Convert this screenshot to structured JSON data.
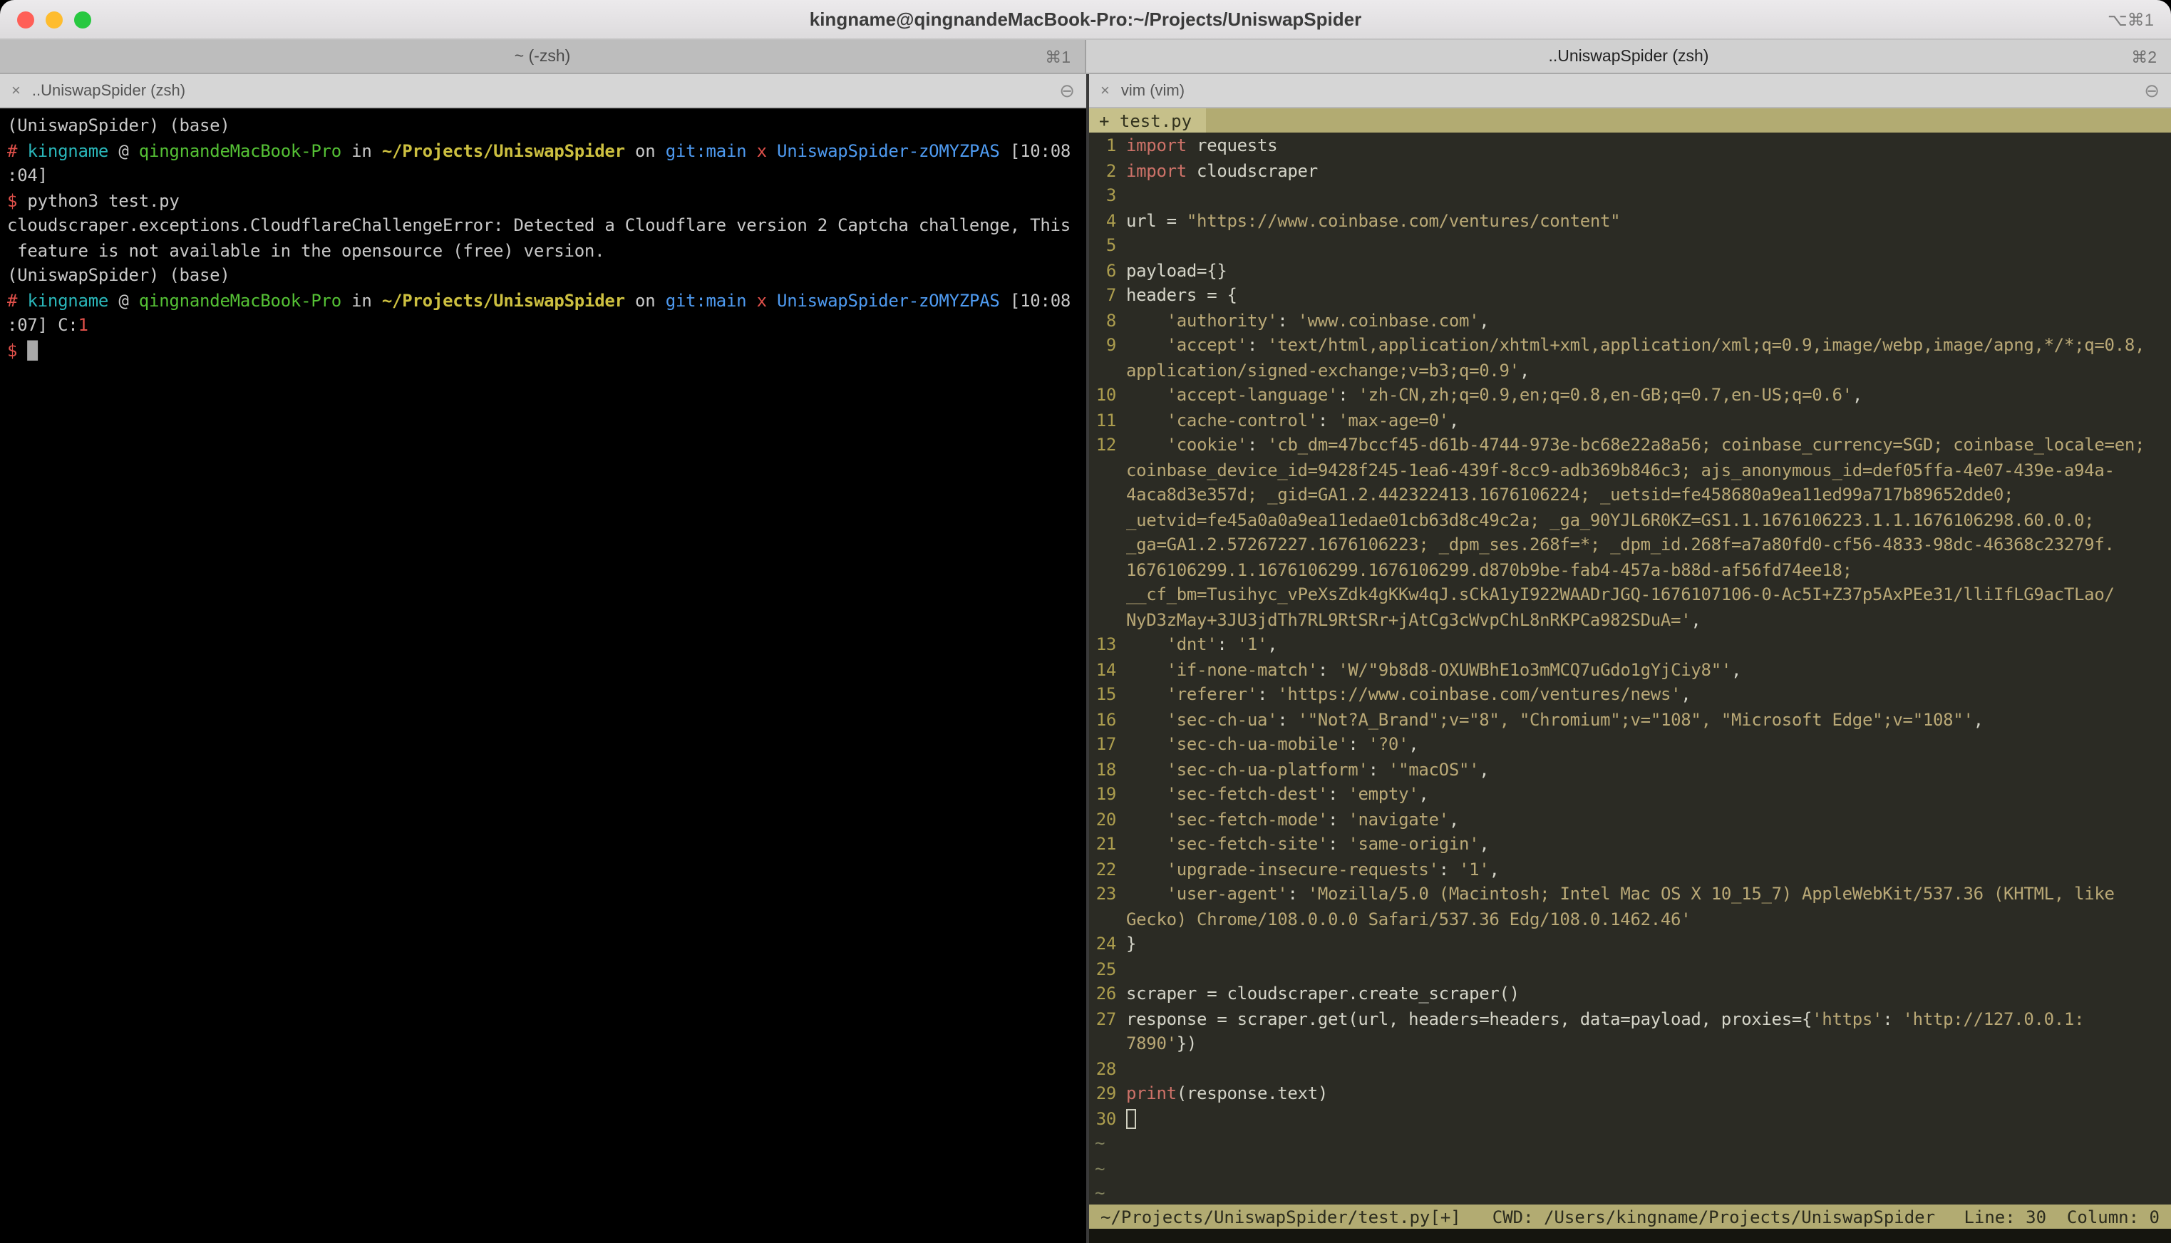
{
  "window": {
    "title": "kingname@qingnandeMacBook-Pro:~/Projects/UniswapSpider",
    "shortcut": "⌥⌘1"
  },
  "tabs": [
    {
      "label": "~ (-zsh)",
      "shortcut": "⌘1"
    },
    {
      "label": "..UniswapSpider (zsh)",
      "shortcut": "⌘2"
    }
  ],
  "left_pane": {
    "title": "..UniswapSpider (zsh)",
    "close_icon": "×",
    "menu_icon": "⊖",
    "lines": [
      [
        {
          "t": "(UniswapSpider) (base)",
          "c": "w"
        }
      ],
      [
        {
          "t": "# ",
          "c": "r"
        },
        {
          "t": "kingname",
          "c": "cy"
        },
        {
          "t": " @ ",
          "c": "w"
        },
        {
          "t": "qingnandeMacBook-Pro",
          "c": "g"
        },
        {
          "t": " in ",
          "c": "w"
        },
        {
          "t": "~/Projects/UniswapSpider",
          "c": "yb"
        },
        {
          "t": " on ",
          "c": "w"
        },
        {
          "t": "git:main",
          "c": "b"
        },
        {
          "t": " x ",
          "c": "r"
        },
        {
          "t": "UniswapSpider-zOMYZPAS",
          "c": "b"
        },
        {
          "t": " [10:08",
          "c": "w"
        }
      ],
      [
        {
          "t": ":04]",
          "c": "w"
        }
      ],
      [
        {
          "t": "$",
          "c": "r"
        },
        {
          "t": " python3 test.py",
          "c": "w"
        }
      ],
      [
        {
          "t": "cloudscraper.exceptions.CloudflareChallengeError: Detected a Cloudflare version 2 Captcha challenge, This",
          "c": "w"
        }
      ],
      [
        {
          "t": " feature is not available in the opensource (free) version.",
          "c": "w"
        }
      ],
      [
        {
          "t": "(UniswapSpider) (base)",
          "c": "w"
        }
      ],
      [
        {
          "t": "# ",
          "c": "r"
        },
        {
          "t": "kingname",
          "c": "cy"
        },
        {
          "t": " @ ",
          "c": "w"
        },
        {
          "t": "qingnandeMacBook-Pro",
          "c": "g"
        },
        {
          "t": " in ",
          "c": "w"
        },
        {
          "t": "~/Projects/UniswapSpider",
          "c": "yb"
        },
        {
          "t": " on ",
          "c": "w"
        },
        {
          "t": "git:main",
          "c": "b"
        },
        {
          "t": " x ",
          "c": "r"
        },
        {
          "t": "UniswapSpider-zOMYZPAS",
          "c": "b"
        },
        {
          "t": " [10:08",
          "c": "w"
        }
      ],
      [
        {
          "t": ":07] ",
          "c": "w"
        },
        {
          "t": "C:",
          "c": "w"
        },
        {
          "t": "1",
          "c": "r"
        }
      ],
      [
        {
          "t": "$ ",
          "c": "r"
        },
        {
          "t": "█",
          "c": "curf"
        }
      ]
    ]
  },
  "right_pane": {
    "title": "vim (vim)",
    "close_icon": "×",
    "menu_icon": "⊖",
    "tabline": "+ test.py",
    "rows": [
      {
        "n": "1",
        "s": [
          {
            "t": "import",
            "c": "kw"
          },
          {
            "t": " requests",
            "c": "p"
          }
        ]
      },
      {
        "n": "2",
        "s": [
          {
            "t": "import",
            "c": "kw"
          },
          {
            "t": " cloudscraper",
            "c": "p"
          }
        ]
      },
      {
        "n": "3",
        "s": []
      },
      {
        "n": "4",
        "s": [
          {
            "t": "url = ",
            "c": "p"
          },
          {
            "t": "\"https://www.coinbase.com/ventures/content\"",
            "c": "s"
          }
        ]
      },
      {
        "n": "5",
        "s": []
      },
      {
        "n": "6",
        "s": [
          {
            "t": "payload={}",
            "c": "p"
          }
        ]
      },
      {
        "n": "7",
        "s": [
          {
            "t": "headers = {",
            "c": "p"
          }
        ]
      },
      {
        "n": "8",
        "s": [
          {
            "t": "    ",
            "c": "p"
          },
          {
            "t": "'authority'",
            "c": "s"
          },
          {
            "t": ": ",
            "c": "p"
          },
          {
            "t": "'www.coinbase.com'",
            "c": "s"
          },
          {
            "t": ",",
            "c": "p"
          }
        ]
      },
      {
        "n": "9",
        "s": [
          {
            "t": "    ",
            "c": "p"
          },
          {
            "t": "'accept'",
            "c": "s"
          },
          {
            "t": ": ",
            "c": "p"
          },
          {
            "t": "'text/html,application/xhtml+xml,application/xml;q=0.9,image/webp,image/apng,*/*;q=0.8,",
            "c": "s"
          }
        ]
      },
      {
        "n": "",
        "s": [
          {
            "t": "application/signed-exchange;v=b3;q=0.9'",
            "c": "s"
          },
          {
            "t": ",",
            "c": "p"
          }
        ]
      },
      {
        "n": "10",
        "s": [
          {
            "t": "    ",
            "c": "p"
          },
          {
            "t": "'accept-language'",
            "c": "s"
          },
          {
            "t": ": ",
            "c": "p"
          },
          {
            "t": "'zh-CN,zh;q=0.9,en;q=0.8,en-GB;q=0.7,en-US;q=0.6'",
            "c": "s"
          },
          {
            "t": ",",
            "c": "p"
          }
        ]
      },
      {
        "n": "11",
        "s": [
          {
            "t": "    ",
            "c": "p"
          },
          {
            "t": "'cache-control'",
            "c": "s"
          },
          {
            "t": ": ",
            "c": "p"
          },
          {
            "t": "'max-age=0'",
            "c": "s"
          },
          {
            "t": ",",
            "c": "p"
          }
        ]
      },
      {
        "n": "12",
        "s": [
          {
            "t": "    ",
            "c": "p"
          },
          {
            "t": "'cookie'",
            "c": "s"
          },
          {
            "t": ": ",
            "c": "p"
          },
          {
            "t": "'cb_dm=47bccf45-d61b-4744-973e-bc68e22a8a56; coinbase_currency=SGD; coinbase_locale=en;",
            "c": "s"
          }
        ]
      },
      {
        "n": "",
        "s": [
          {
            "t": "coinbase_device_id=9428f245-1ea6-439f-8cc9-adb369b846c3; ajs_anonymous_id=def05ffa-4e07-439e-a94a-",
            "c": "s"
          }
        ]
      },
      {
        "n": "",
        "s": [
          {
            "t": "4aca8d3e357d; _gid=GA1.2.442322413.1676106224; _uetsid=fe458680a9ea11ed99a717b89652dde0;",
            "c": "s"
          }
        ]
      },
      {
        "n": "",
        "s": [
          {
            "t": "_uetvid=fe45a0a0a9ea11edae01cb63d8c49c2a; _ga_90YJL6R0KZ=GS1.1.1676106223.1.1.1676106298.60.0.0;",
            "c": "s"
          }
        ]
      },
      {
        "n": "",
        "s": [
          {
            "t": "_ga=GA1.2.57267227.1676106223; _dpm_ses.268f=*; _dpm_id.268f=a7a80fd0-cf56-4833-98dc-46368c23279f.",
            "c": "s"
          }
        ]
      },
      {
        "n": "",
        "s": [
          {
            "t": "1676106299.1.1676106299.1676106299.d870b9be-fab4-457a-b88d-af56fd74ee18;",
            "c": "s"
          }
        ]
      },
      {
        "n": "",
        "s": [
          {
            "t": "__cf_bm=Tusihyc_vPeXsZdk4gKKw4qJ.sCkA1yI922WAADrJGQ-1676107106-0-Ac5I+Z37p5AxPEe31/lliIfLG9acTLao/",
            "c": "s"
          }
        ]
      },
      {
        "n": "",
        "s": [
          {
            "t": "NyD3zMay+3JU3jdTh7RL9RtSRr+jAtCg3cWvpChL8nRKPCa982SDuA='",
            "c": "s"
          },
          {
            "t": ",",
            "c": "p"
          }
        ]
      },
      {
        "n": "13",
        "s": [
          {
            "t": "    ",
            "c": "p"
          },
          {
            "t": "'dnt'",
            "c": "s"
          },
          {
            "t": ": ",
            "c": "p"
          },
          {
            "t": "'1'",
            "c": "s"
          },
          {
            "t": ",",
            "c": "p"
          }
        ]
      },
      {
        "n": "14",
        "s": [
          {
            "t": "    ",
            "c": "p"
          },
          {
            "t": "'if-none-match'",
            "c": "s"
          },
          {
            "t": ": ",
            "c": "p"
          },
          {
            "t": "'W/\"9b8d8-OXUWBhE1o3mMCQ7uGdo1gYjCiy8\"'",
            "c": "s"
          },
          {
            "t": ",",
            "c": "p"
          }
        ]
      },
      {
        "n": "15",
        "s": [
          {
            "t": "    ",
            "c": "p"
          },
          {
            "t": "'referer'",
            "c": "s"
          },
          {
            "t": ": ",
            "c": "p"
          },
          {
            "t": "'https://www.coinbase.com/ventures/news'",
            "c": "s"
          },
          {
            "t": ",",
            "c": "p"
          }
        ]
      },
      {
        "n": "16",
        "s": [
          {
            "t": "    ",
            "c": "p"
          },
          {
            "t": "'sec-ch-ua'",
            "c": "s"
          },
          {
            "t": ": ",
            "c": "p"
          },
          {
            "t": "'\"Not?A_Brand\";v=\"8\", \"Chromium\";v=\"108\", \"Microsoft Edge\";v=\"108\"'",
            "c": "s"
          },
          {
            "t": ",",
            "c": "p"
          }
        ]
      },
      {
        "n": "17",
        "s": [
          {
            "t": "    ",
            "c": "p"
          },
          {
            "t": "'sec-ch-ua-mobile'",
            "c": "s"
          },
          {
            "t": ": ",
            "c": "p"
          },
          {
            "t": "'?0'",
            "c": "s"
          },
          {
            "t": ",",
            "c": "p"
          }
        ]
      },
      {
        "n": "18",
        "s": [
          {
            "t": "    ",
            "c": "p"
          },
          {
            "t": "'sec-ch-ua-platform'",
            "c": "s"
          },
          {
            "t": ": ",
            "c": "p"
          },
          {
            "t": "'\"macOS\"'",
            "c": "s"
          },
          {
            "t": ",",
            "c": "p"
          }
        ]
      },
      {
        "n": "19",
        "s": [
          {
            "t": "    ",
            "c": "p"
          },
          {
            "t": "'sec-fetch-dest'",
            "c": "s"
          },
          {
            "t": ": ",
            "c": "p"
          },
          {
            "t": "'empty'",
            "c": "s"
          },
          {
            "t": ",",
            "c": "p"
          }
        ]
      },
      {
        "n": "20",
        "s": [
          {
            "t": "    ",
            "c": "p"
          },
          {
            "t": "'sec-fetch-mode'",
            "c": "s"
          },
          {
            "t": ": ",
            "c": "p"
          },
          {
            "t": "'navigate'",
            "c": "s"
          },
          {
            "t": ",",
            "c": "p"
          }
        ]
      },
      {
        "n": "21",
        "s": [
          {
            "t": "    ",
            "c": "p"
          },
          {
            "t": "'sec-fetch-site'",
            "c": "s"
          },
          {
            "t": ": ",
            "c": "p"
          },
          {
            "t": "'same-origin'",
            "c": "s"
          },
          {
            "t": ",",
            "c": "p"
          }
        ]
      },
      {
        "n": "22",
        "s": [
          {
            "t": "    ",
            "c": "p"
          },
          {
            "t": "'upgrade-insecure-requests'",
            "c": "s"
          },
          {
            "t": ": ",
            "c": "p"
          },
          {
            "t": "'1'",
            "c": "s"
          },
          {
            "t": ",",
            "c": "p"
          }
        ]
      },
      {
        "n": "23",
        "s": [
          {
            "t": "    ",
            "c": "p"
          },
          {
            "t": "'user-agent'",
            "c": "s"
          },
          {
            "t": ": ",
            "c": "p"
          },
          {
            "t": "'Mozilla/5.0 (Macintosh; Intel Mac OS X 10_15_7) AppleWebKit/537.36 (KHTML, like",
            "c": "s"
          }
        ]
      },
      {
        "n": "",
        "s": [
          {
            "t": "Gecko) Chrome/108.0.0.0 Safari/537.36 Edg/108.0.1462.46'",
            "c": "s"
          }
        ]
      },
      {
        "n": "24",
        "s": [
          {
            "t": "}",
            "c": "p"
          }
        ]
      },
      {
        "n": "25",
        "s": []
      },
      {
        "n": "26",
        "s": [
          {
            "t": "scraper = cloudscraper.create_scraper()",
            "c": "p"
          }
        ]
      },
      {
        "n": "27",
        "s": [
          {
            "t": "response = scraper.get(url, headers=headers, data=payload, proxies={",
            "c": "p"
          },
          {
            "t": "'https'",
            "c": "s"
          },
          {
            "t": ": ",
            "c": "p"
          },
          {
            "t": "'http://127.0.0.1:",
            "c": "s"
          }
        ]
      },
      {
        "n": "",
        "s": [
          {
            "t": "7890'",
            "c": "s"
          },
          {
            "t": "})",
            "c": "p"
          }
        ]
      },
      {
        "n": "28",
        "s": []
      },
      {
        "n": "29",
        "s": [
          {
            "t": "print",
            "c": "kw"
          },
          {
            "t": "(response.text)",
            "c": "p"
          }
        ]
      },
      {
        "n": "30",
        "s": [
          {
            "t": " ",
            "c": "curh"
          }
        ]
      }
    ],
    "fillers": [
      "~",
      "~",
      "~"
    ],
    "statusbar": {
      "file": "~/Projects/UniswapSpider/test.py[+]",
      "cwd": "CWD: /Users/kingname/Projects/UniswapSpider",
      "position": "Line: 30  Column: 0"
    }
  },
  "colors": {
    "terminal_background": "#000000",
    "vim_background": "#2b2b24",
    "khaki_bar": "#b2ab72",
    "prompt_red": "#e0504a",
    "user_cyan": "#2ab7ba",
    "host_green": "#55c135",
    "path_yellow": "#cdc040",
    "git_blue": "#4e9af0",
    "keyword_salmon": "#cd7268",
    "string_khaki": "#b9a876",
    "line_number_olive": "#ac9d4e",
    "traffic_red": "#ff5f57",
    "traffic_yellow": "#febc2e",
    "traffic_green": "#28c840"
  }
}
